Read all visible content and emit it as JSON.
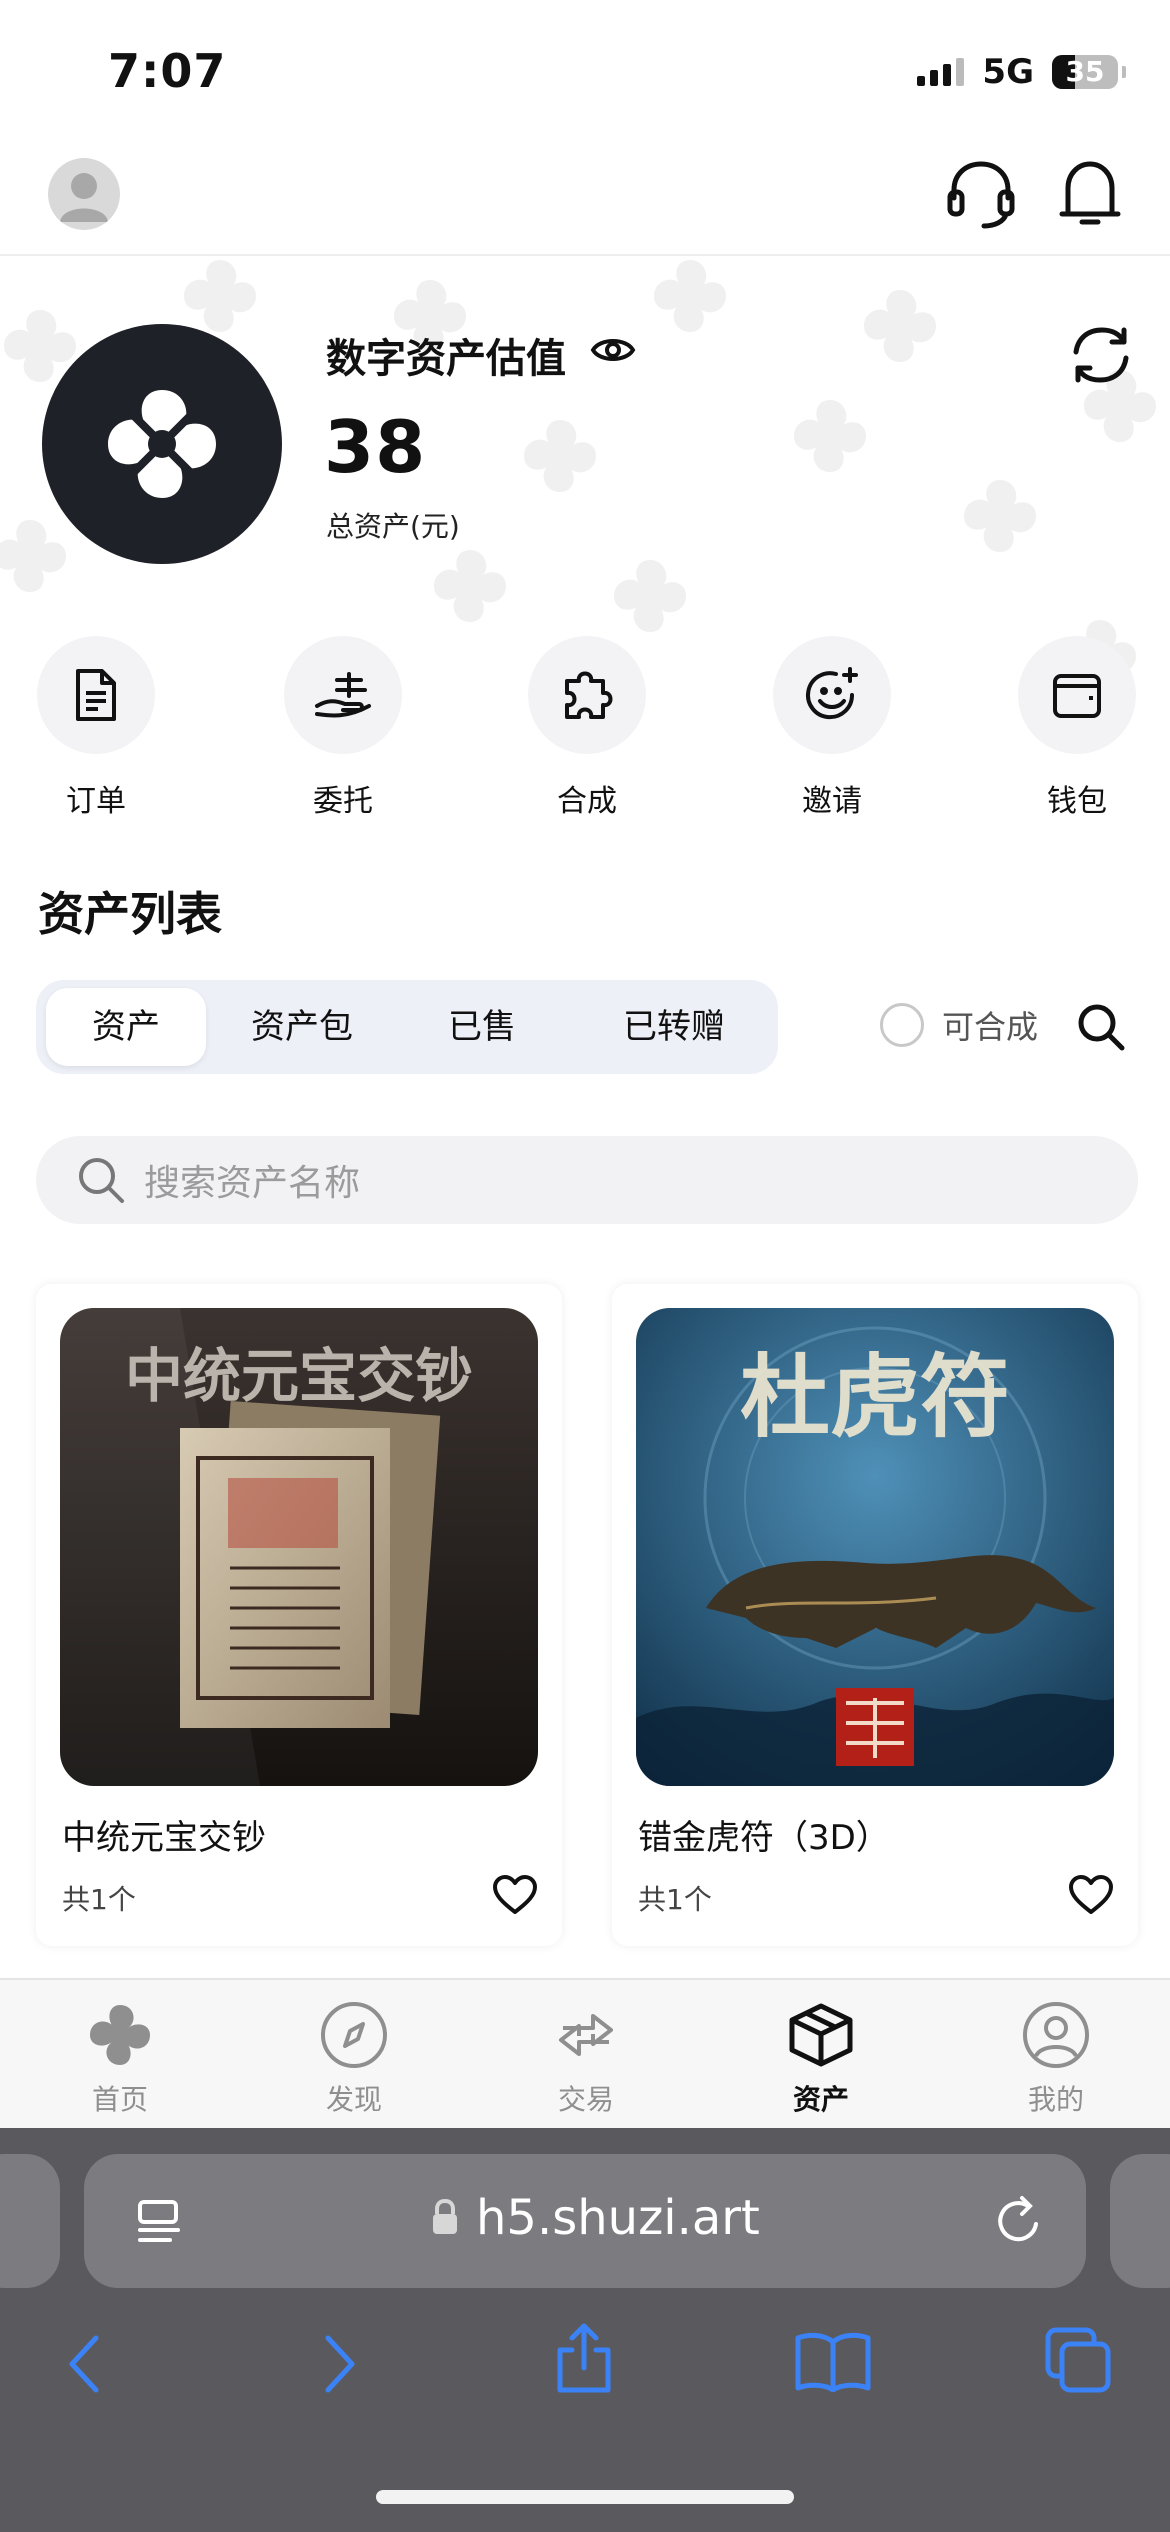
{
  "status_bar": {
    "time": "7:07",
    "network": "5G",
    "battery": "35",
    "battery_fraction": 0.35
  },
  "header": {
    "avatar_icon": "user-avatar-icon",
    "support_icon": "headset-icon",
    "notification_icon": "bell-icon"
  },
  "hero": {
    "title": "数字资产估值",
    "value": "38",
    "subtitle": "总资产(元)"
  },
  "shortcuts": [
    {
      "label": "订单",
      "icon": "document-icon"
    },
    {
      "label": "委托",
      "icon": "hand-coin-icon"
    },
    {
      "label": "合成",
      "icon": "puzzle-icon"
    },
    {
      "label": "邀请",
      "icon": "smile-plus-icon"
    },
    {
      "label": "钱包",
      "icon": "wallet-icon"
    }
  ],
  "asset_list": {
    "title": "资产列表",
    "tabs": [
      "资产",
      "资产包",
      "已售",
      "已转赠"
    ],
    "active_tab": 0,
    "merge_toggle_label": "可合成",
    "search_placeholder": "搜索资产名称"
  },
  "cards": [
    {
      "name": "中统元宝交钞",
      "count": "共1个",
      "image_caption": "中统元宝交钞"
    },
    {
      "name": "错金虎符（3D）",
      "count": "共1个",
      "image_caption": "杜虎符"
    }
  ],
  "bottom_nav": [
    {
      "label": "首页",
      "icon": "home-logo-icon"
    },
    {
      "label": "发现",
      "icon": "compass-icon"
    },
    {
      "label": "交易",
      "icon": "exchange-icon"
    },
    {
      "label": "资产",
      "icon": "cube-icon",
      "active": true
    },
    {
      "label": "我的",
      "icon": "profile-icon"
    }
  ],
  "browser": {
    "url": "h5.shuzi.art"
  },
  "colors": {
    "accent_dark": "#1e2128",
    "browser_blue": "#3b82f6",
    "tab_bg": "#eef0f8"
  }
}
